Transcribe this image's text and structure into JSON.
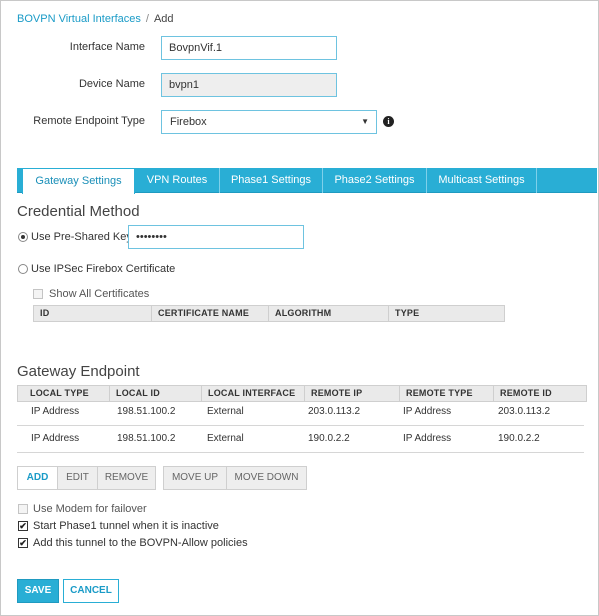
{
  "breadcrumb": {
    "parent": "BOVPN Virtual Interfaces",
    "separator": "/",
    "current": "Add"
  },
  "form": {
    "interface_name": {
      "label": "Interface Name",
      "value": "BovpnVif.1"
    },
    "device_name": {
      "label": "Device Name",
      "value": "bvpn1"
    },
    "remote_endpoint_type": {
      "label": "Remote Endpoint Type",
      "value": "Firebox",
      "arrow": "▼",
      "info_icon": "i"
    }
  },
  "tabs": [
    {
      "label": "Gateway Settings"
    },
    {
      "label": "VPN Routes"
    },
    {
      "label": "Phase1 Settings"
    },
    {
      "label": "Phase2 Settings"
    },
    {
      "label": "Multicast Settings"
    }
  ],
  "credential": {
    "title": "Credential Method",
    "psk_label": "Use Pre-Shared Key",
    "psk_value": "••••••••",
    "cert_label": "Use IPSec Firebox Certificate",
    "show_all_label": "Show All Certificates",
    "cert_columns": [
      "ID",
      "CERTIFICATE NAME",
      "ALGORITHM",
      "TYPE"
    ]
  },
  "gateway": {
    "title": "Gateway Endpoint",
    "columns": [
      "LOCAL TYPE",
      "LOCAL ID",
      "LOCAL INTERFACE",
      "REMOTE IP",
      "REMOTE TYPE",
      "REMOTE ID"
    ],
    "rows": [
      [
        "IP Address",
        "198.51.100.2",
        "External",
        "203.0.113.2",
        "IP Address",
        "203.0.113.2"
      ],
      [
        "IP Address",
        "198.51.100.2",
        "External",
        "190.0.2.2",
        "IP Address",
        "190.0.2.2"
      ]
    ],
    "buttons": {
      "add": "ADD",
      "edit": "EDIT",
      "remove": "REMOVE",
      "move_up": "MOVE UP",
      "move_down": "MOVE DOWN"
    }
  },
  "options": {
    "modem_failover": "Use Modem for failover",
    "start_phase1": "Start Phase1 tunnel when it is inactive",
    "add_tunnel": "Add this tunnel to the BOVPN-Allow policies"
  },
  "checkmark": "✔",
  "footer": {
    "save": "SAVE",
    "cancel": "CANCEL"
  },
  "colors": {
    "accent": "#29aed5",
    "link": "#1a9bc7"
  }
}
